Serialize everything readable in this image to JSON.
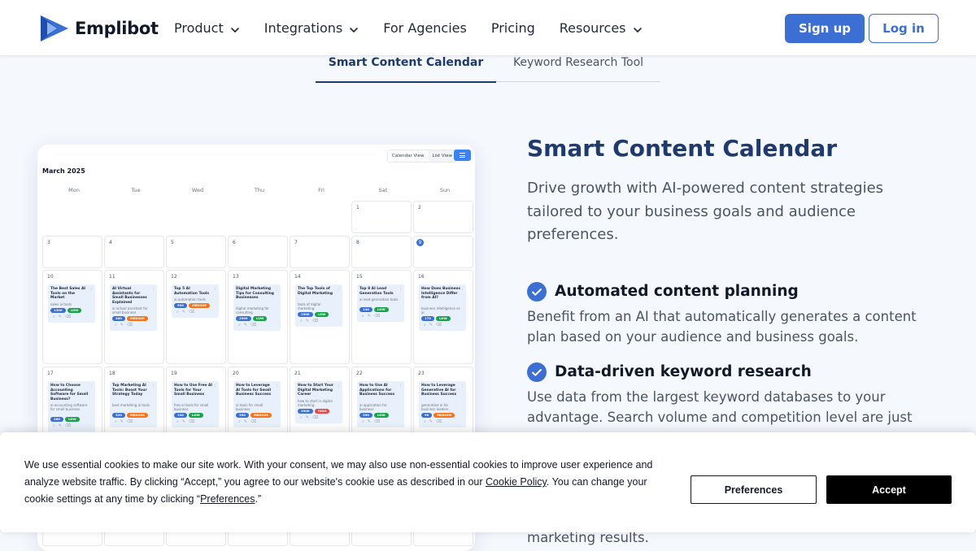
{
  "header": {
    "logo_text": "Emplibot",
    "nav": [
      {
        "label": "Product",
        "has_dropdown": true
      },
      {
        "label": "Integrations",
        "has_dropdown": true
      },
      {
        "label": "For Agencies",
        "has_dropdown": false
      },
      {
        "label": "Pricing",
        "has_dropdown": false
      },
      {
        "label": "Resources",
        "has_dropdown": true
      }
    ],
    "signup_label": "Sign up",
    "login_label": "Log in"
  },
  "tabs": [
    {
      "label": "Smart Content Calendar",
      "active": true
    },
    {
      "label": "Keyword Research Tool",
      "active": false
    }
  ],
  "calendar": {
    "view_calendar": "Calendar View",
    "view_list": "List View",
    "month": "March 2025",
    "weekdays": [
      "Mon",
      "Tue",
      "Wed",
      "Thu",
      "Fri",
      "Sat",
      "Sun"
    ],
    "row1": [
      "1",
      "2"
    ],
    "row2": [
      "3",
      "4",
      "5",
      "6",
      "7",
      "8",
      "9"
    ],
    "today": "9",
    "week3": [
      {
        "day": "10",
        "title": "The Best Sales AI Tools on the Market",
        "keyword": "sales ai tools",
        "volume": "1300",
        "level": "LOW"
      },
      {
        "day": "11",
        "title": "AI Virtual Assistants for Small Businesses Explained",
        "keyword": "ai virtual assistant for small business",
        "volume": "480",
        "level": "MEDIUM"
      },
      {
        "day": "12",
        "title": "Top 5 AI Automation Tools",
        "keyword": "ai automation tools",
        "volume": "590",
        "level": "MEDIUM"
      },
      {
        "day": "13",
        "title": "Digital Marketing Tips for Consulting Businesses",
        "keyword": "digital marketing for consulting",
        "volume": "2900",
        "level": "LOW"
      },
      {
        "day": "14",
        "title": "The Top Tools of Digital Marketing",
        "keyword": "tools of digital marketing",
        "volume": "1900",
        "level": "LOW"
      },
      {
        "day": "15",
        "title": "Top 8 AI Lead Generation Tools",
        "keyword": "ai lead generation tools",
        "volume": "140",
        "level": "LOW"
      },
      {
        "day": "16",
        "title": "How Does Business Intelligence Differ from AI?",
        "keyword": "business intelligence vs ai",
        "volume": "170",
        "level": "LOW"
      }
    ],
    "week4": [
      {
        "day": "17",
        "title": "How to Choose Accounting Software for Small Business?",
        "keyword": "ai accounting software for small business",
        "volume": "260",
        "level": "LOW"
      },
      {
        "day": "18",
        "title": "Top Marketing AI Tools: Boost Your Strategy Today",
        "keyword": "best marketing ai tools",
        "volume": "320",
        "level": "MEDIUM"
      },
      {
        "day": "19",
        "title": "How to Use Free AI Tools for Your Small Business",
        "keyword": "free ai tools for small business",
        "volume": "140",
        "level": "LOW"
      },
      {
        "day": "20",
        "title": "How to Leverage AI Tools for Small Business Success",
        "keyword": "ai tools for small business",
        "volume": "390",
        "level": "MEDIUM"
      },
      {
        "day": "21",
        "title": "How to Start Your Digital Marketing Career",
        "keyword": "how to start in digital marketing",
        "volume": "2900",
        "level": "HIGH"
      },
      {
        "day": "22",
        "title": "How to Use AI Applications for Business Success",
        "keyword": "ai application for business",
        "volume": "390",
        "level": "LOW"
      },
      {
        "day": "23",
        "title": "How to Leverage Generative AI for Business Success",
        "keyword": "generative ai for business leaders",
        "volume": "90",
        "level": "MEDIUM"
      }
    ],
    "level_colors": {
      "LOW": "#16a34a",
      "MEDIUM": "#f97316",
      "HIGH": "#ef4444"
    },
    "volume_color": "#3b6fd4"
  },
  "feature": {
    "title": "Smart Content Calendar",
    "description": "Drive growth with AI-powered content strategies tailored to your business goals and audience preferences.",
    "points": [
      {
        "title": "Automated content planning",
        "text": "Benefit from an AI that automatically generates a content plan based on your audience and business goals."
      },
      {
        "title": "Data-driven keyword research",
        "text": "Use data from the largest keyword databases to your advantage. Search volume and competition level are just"
      }
    ],
    "trailing_text": "marketing results."
  },
  "cookie": {
    "text_1": "We use essential cookies to make our site work. With your consent, we may also use non-essential cookies to improve user experience and analyze website traffic. By clicking “Accept,” you agree to our website's cookie use as described in our ",
    "policy_link": "Cookie Policy",
    "text_2": ". You can change your cookie settings at any time by clicking “",
    "preferences_link": "Preferences",
    "text_3": ".”",
    "preferences_button": "Preferences",
    "accept_button": "Accept"
  },
  "colors": {
    "brand": "#3b6fd4",
    "heading": "#1e3a6e"
  }
}
